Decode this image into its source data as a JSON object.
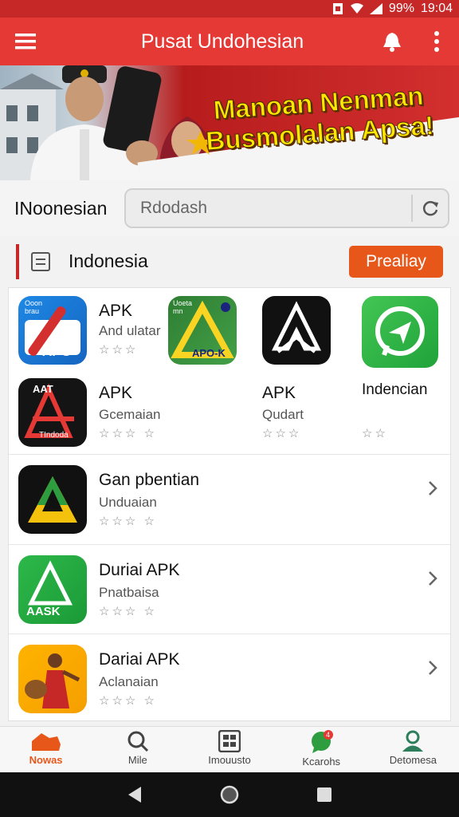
{
  "status_bar": {
    "battery": "99%",
    "time": "19:04"
  },
  "app_bar": {
    "title": "Pusat Undohesian"
  },
  "banner": {
    "headline_line1": "Manoan Nenman",
    "headline_line2": "Busmolalan Apsa!"
  },
  "search": {
    "label": "INoonesian",
    "placeholder": "Rdodash"
  },
  "section": {
    "title": "Indonesia",
    "button": "Prealiay"
  },
  "colors": {
    "primary": "#e53935",
    "statusbar": "#c62828",
    "accent": "#e8571a"
  },
  "grid_apps": [
    {
      "name": "APK",
      "subtitle": "And ulatar",
      "icon_text": "APC",
      "icon_caption": "Ooon brau"
    },
    {
      "icon_text": "APO-K",
      "icon_caption": "Uoeta mn"
    },
    {
      "icon": "trident-logo-icon"
    },
    {
      "icon": "paper-plane-icon"
    },
    {
      "name": "APK",
      "subtitle": "Gcemaian",
      "icon_text": "AAT",
      "icon_caption": "TIndoda"
    },
    {
      "name": "APK",
      "subtitle": "Qudart"
    },
    {
      "name": "Indencian"
    }
  ],
  "list_apps": [
    {
      "name": "Gan pbentian",
      "subtitle": "Unduaian"
    },
    {
      "name": "Duriai APK",
      "subtitle": "Pnatbaisa",
      "icon_text": "AASK"
    },
    {
      "name": "Dariai APK",
      "subtitle": "Aclanaian"
    }
  ],
  "rating": {
    "stars_3": "☆☆☆ ☆",
    "stars_short": "☆☆☆",
    "stars_2": "☆☆"
  },
  "bottom_nav": [
    {
      "label": "Nowas"
    },
    {
      "label": "Mile"
    },
    {
      "label": "Imouusto"
    },
    {
      "label": "Kcarohs",
      "badge": "4"
    },
    {
      "label": "Detomesa"
    }
  ]
}
